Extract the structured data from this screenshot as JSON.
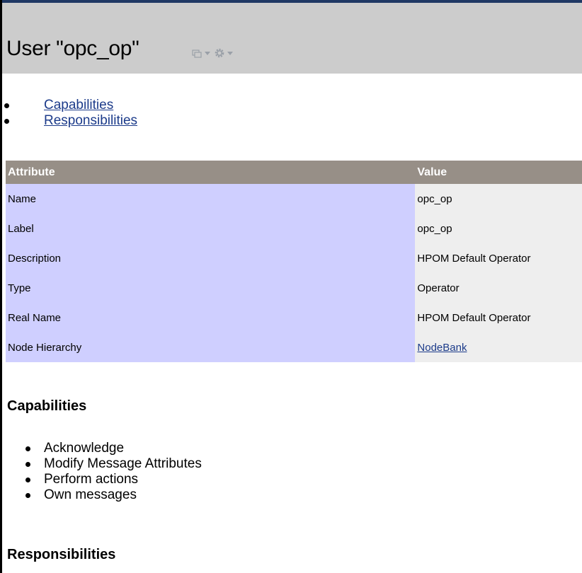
{
  "header": {
    "title": "User \"opc_op\"",
    "icons": [
      "open-window-icon",
      "chevron-down-icon",
      "gear-icon",
      "chevron-down-icon"
    ]
  },
  "nav_links": [
    "Capabilities",
    "Responsibilities"
  ],
  "table": {
    "headers": [
      "Attribute",
      "Value"
    ],
    "rows": [
      {
        "attribute": "Name",
        "value": "opc_op"
      },
      {
        "attribute": "Label",
        "value": "opc_op"
      },
      {
        "attribute": "Description",
        "value": "HPOM Default Operator"
      },
      {
        "attribute": "Type",
        "value": "Operator"
      },
      {
        "attribute": "Real Name",
        "value": "HPOM Default Operator"
      },
      {
        "attribute": "Node Hierarchy",
        "value": "NodeBank"
      }
    ]
  },
  "capabilities": {
    "heading": "Capabilities",
    "items": [
      "Acknowledge",
      "Modify Message Attributes",
      "Perform actions",
      "Own messages"
    ]
  },
  "responsibilities": {
    "heading": "Responsibilities"
  },
  "colors": {
    "header_bg": "#cccccc",
    "table_header_bg": "#978f87",
    "attribute_cell_bg": "#cfcfff",
    "value_cell_bg": "#eeeeee",
    "link": "#1c3b8a"
  }
}
